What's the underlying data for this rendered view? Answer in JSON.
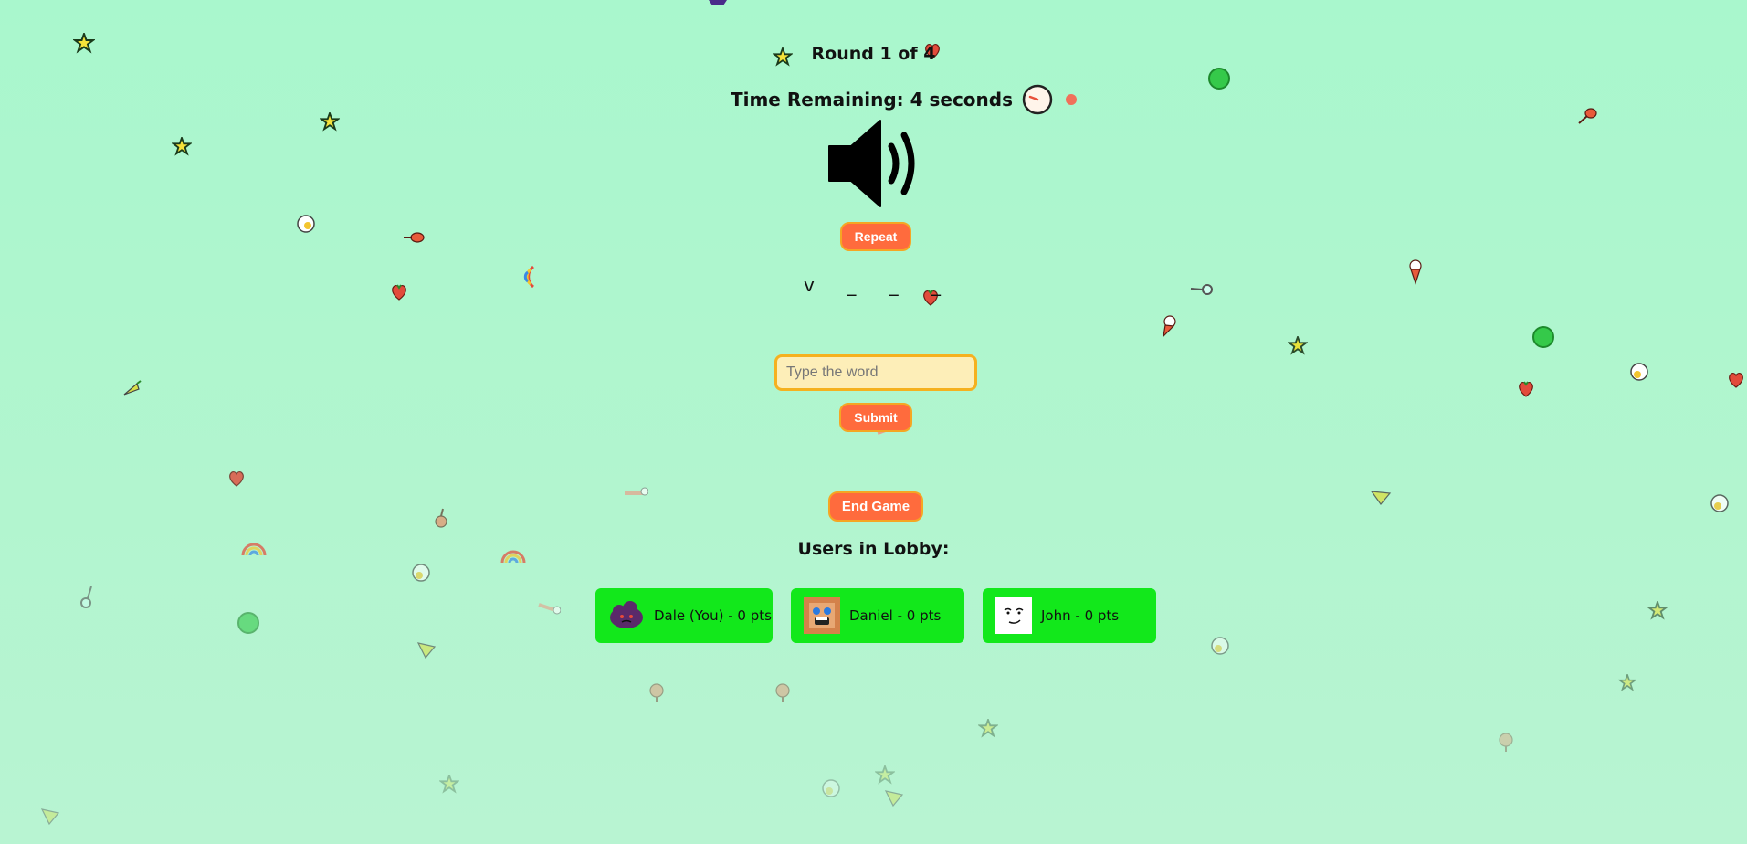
{
  "game": {
    "round_label": "Round 1 of 4",
    "timer_label": "Time Remaining: 4 seconds",
    "word_slots": [
      "v",
      "_",
      "_",
      "_"
    ],
    "input_placeholder": "Type the word",
    "input_value": "",
    "buttons": {
      "repeat": "Repeat",
      "submit": "Submit",
      "end_game": "End Game"
    }
  },
  "lobby": {
    "title": "Users in Lobby:",
    "players": [
      {
        "label": "Dale (You) - 0 pts",
        "avatar": "purple-cloud-avatar"
      },
      {
        "label": "Daniel - 0 pts",
        "avatar": "crying-face-avatar"
      },
      {
        "label": "John - 0 pts",
        "avatar": "smirk-face-avatar"
      }
    ]
  },
  "colors": {
    "background": "#a9f7cd",
    "button": "#ff6b3d",
    "button_border": "#f5a623",
    "player_card": "#12e81b",
    "input_bg": "#fdeeb8"
  },
  "icons": {
    "speaker": "speaker-volume-icon",
    "timer": "clock-icon"
  }
}
